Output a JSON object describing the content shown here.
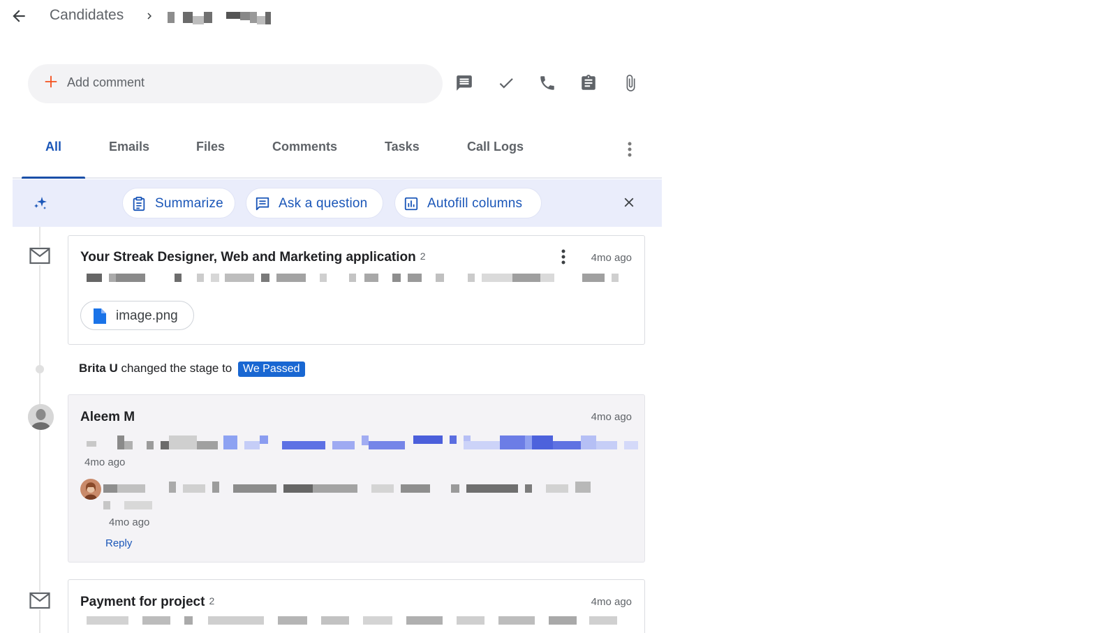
{
  "breadcrumb": {
    "root": "Candidates"
  },
  "comment_bar": {
    "placeholder": "Add comment"
  },
  "actions": [
    "comment-icon",
    "task-check-icon",
    "phone-icon",
    "clipboard-icon",
    "attachment-icon"
  ],
  "tabs": [
    {
      "label": "All",
      "active": true
    },
    {
      "label": "Emails",
      "active": false
    },
    {
      "label": "Files",
      "active": false
    },
    {
      "label": "Comments",
      "active": false
    },
    {
      "label": "Tasks",
      "active": false
    },
    {
      "label": "Call Logs",
      "active": false
    }
  ],
  "ai_bar": {
    "chips": [
      {
        "label": "Summarize",
        "icon": "clipboard-icon"
      },
      {
        "label": "Ask a question",
        "icon": "chat-icon"
      },
      {
        "label": "Autofill columns",
        "icon": "chart-icon"
      }
    ]
  },
  "timeline": {
    "email1": {
      "title": "Your Streak Designer, Web and Marketing application",
      "count": "2",
      "time": "4mo ago",
      "attachment": "image.png"
    },
    "stage_change": {
      "actor": "Brita U",
      "text": "changed the stage to",
      "stage": "We Passed"
    },
    "comment": {
      "author": "Aleem M",
      "time": "4mo ago",
      "sub_time": "4mo ago",
      "reply_time": "4mo ago",
      "reply_label": "Reply"
    },
    "email2": {
      "title": "Payment for project",
      "count": "2",
      "time": "4mo ago"
    }
  },
  "colors": {
    "accent": "#1a56b8",
    "stage_badge": "#1967d2",
    "ai_bar_bg": "#eaedfb",
    "plus_orange": "#f4511e"
  }
}
